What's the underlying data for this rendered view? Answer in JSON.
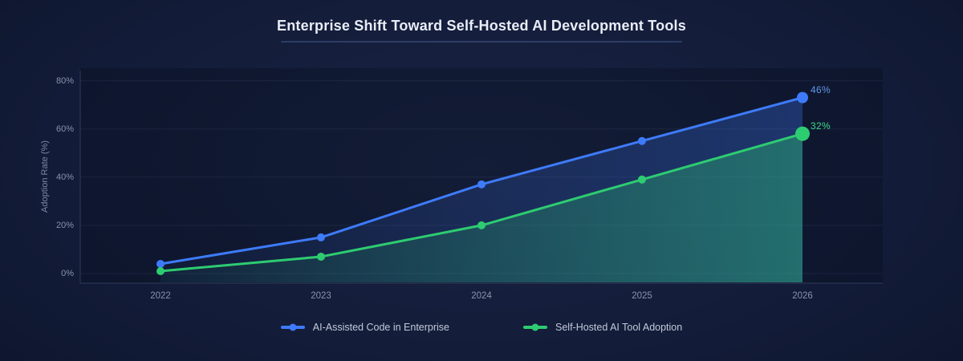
{
  "title": "Enterprise Shift Toward Self-Hosted AI Development Tools",
  "chart_data": {
    "type": "line",
    "x": [
      "2022",
      "2023",
      "2024",
      "2025",
      "2026"
    ],
    "series": [
      {
        "name": "AI-Assisted Code in Enterprise",
        "values": [
          4,
          15,
          37,
          55,
          73
        ],
        "color": "#3e7bfa",
        "end_label": "46%",
        "end_label_color": "#6496e8"
      },
      {
        "name": "Self-Hosted AI Tool Adoption",
        "values": [
          1,
          7,
          20,
          39,
          58
        ],
        "color": "#2ecc71",
        "end_label": "32%",
        "end_label_color": "#3bd98a"
      }
    ],
    "xlabel": "",
    "ylabel": "Adoption Rate (%)",
    "yticks": [
      "0%",
      "20%",
      "40%",
      "60%",
      "80%"
    ],
    "ytick_values": [
      0,
      20,
      40,
      60,
      80
    ],
    "ylim": [
      0,
      80
    ],
    "grid": true,
    "area_fill": true,
    "legend_position": "bottom"
  },
  "colors": {
    "background": "#121b37",
    "grid": "rgba(135,155,205,0.10)",
    "axis": "rgba(140,160,205,0.25)",
    "tick_text": "#8a93ab",
    "title_text": "#e9edf7",
    "legend_text": "#c3cad9"
  }
}
